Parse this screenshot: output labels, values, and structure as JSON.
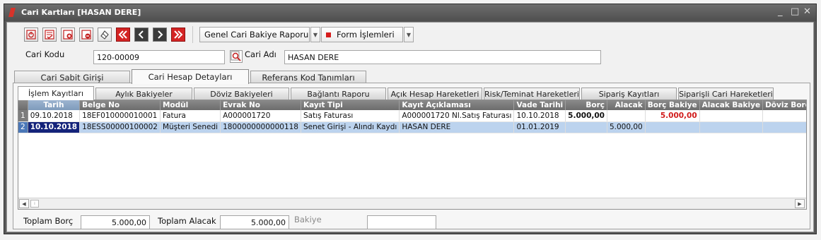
{
  "window": {
    "title": "Cari Kartları [HASAN DERE]",
    "controls": {
      "minimize": "_",
      "maximize": "□",
      "close": "✕"
    }
  },
  "toolbar": {
    "report_button": "Genel Cari Bakiye Raporu",
    "form_button": "Form İşlemleri",
    "icons": [
      "power-icon",
      "checklist-icon",
      "add-record-icon",
      "remove-record-icon",
      "eraser-icon",
      "first-record-icon",
      "previous-record-icon",
      "next-record-icon",
      "last-record-icon"
    ],
    "accent_red": "#d61c1c"
  },
  "header": {
    "code_label": "Cari Kodu",
    "code_value": "120-00009",
    "name_label": "Cari Adı",
    "name_value": "HASAN DERE"
  },
  "main_tabs": [
    {
      "label": "Cari Sabit Girişi",
      "active": false
    },
    {
      "label": "Cari Hesap Detayları",
      "active": true
    },
    {
      "label": "Referans Kod Tanımları",
      "active": false
    }
  ],
  "sub_tabs": [
    {
      "label": "İşlem Kayıtları",
      "active": true
    },
    {
      "label": "Aylık Bakiyeler",
      "active": false
    },
    {
      "label": "Döviz Bakiyeleri",
      "active": false
    },
    {
      "label": "Bağlantı Raporu",
      "active": false
    },
    {
      "label": "Açık Hesap Hareketleri",
      "active": false
    },
    {
      "label": "Risk/Teminat Hareketleri",
      "active": false
    },
    {
      "label": "Sipariş Kayıtları",
      "active": false
    },
    {
      "label": "Siparişli Cari Hareketleri",
      "active": false
    }
  ],
  "table": {
    "columns": [
      "",
      "Tarih",
      "Belge No",
      "Modül",
      "Evrak No",
      "Kayıt Tipi",
      "Kayıt Açıklaması",
      "Vade Tarihi",
      "Borç",
      "Alacak",
      "Borç Bakiye",
      "Alacak Bakiye",
      "Döviz Borç"
    ],
    "rows": [
      [
        "1",
        "09.10.2018",
        "18EF010000010001",
        "Fatura",
        "A000001720",
        "Satış Faturası",
        "A000001720 Nl.Satış Faturası",
        "10.10.2018",
        "5.000,00",
        "",
        "5.000,00",
        "",
        ""
      ],
      [
        "2",
        "10.10.2018",
        "18ESS00000100002",
        "Müşteri Senedi",
        "1800000000000118",
        "Senet Girişi - Alındı Kaydı",
        "HASAN DERE",
        "01.01.2019",
        "",
        "5.000,00",
        "",
        "",
        ""
      ]
    ]
  },
  "footer": {
    "total_debit_label": "Toplam Borç",
    "total_debit_value": "5.000,00",
    "total_credit_label": "Toplam Alacak",
    "total_credit_value": "5.000,00",
    "balance_label": "Bakiye",
    "balance_value": ""
  }
}
